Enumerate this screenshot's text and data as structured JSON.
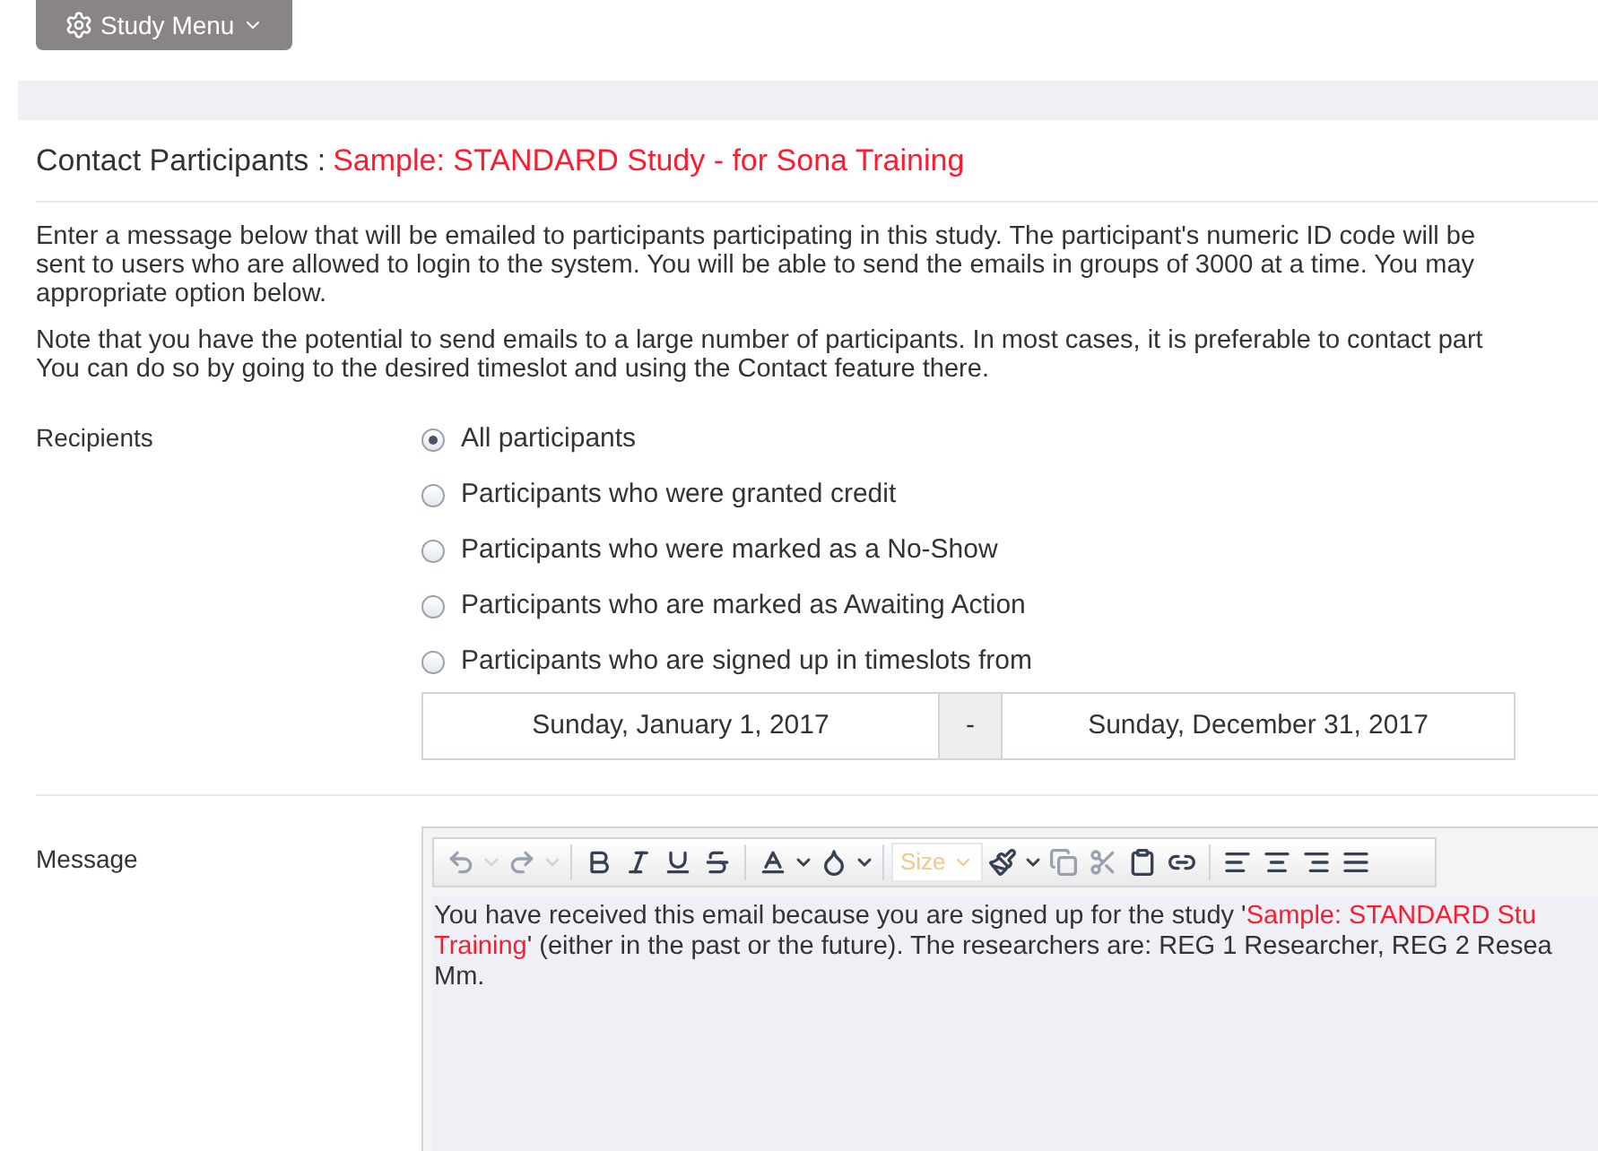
{
  "study_menu": {
    "label": "Study Menu"
  },
  "heading": {
    "label": "Contact Participants :",
    "study": "Sample: STANDARD Study - for Sona Training"
  },
  "intro_lines": [
    "Enter a message below that will be emailed to participants participating in this study. The participant's numeric ID code will be",
    "sent to users who are allowed to login to the system. You will be able to send the emails in groups of 3000 at a time. You may",
    "appropriate option below."
  ],
  "note_lines": [
    "Note that you have the potential to send emails to a large number of participants. In most cases, it is preferable to contact part",
    "You can do so by going to the desired timeslot and using the Contact feature there."
  ],
  "recipients": {
    "label": "Recipients",
    "options": [
      {
        "label": "All participants",
        "selected": true
      },
      {
        "label": "Participants who were granted credit",
        "selected": false
      },
      {
        "label": "Participants who were marked as a No-Show",
        "selected": false
      },
      {
        "label": "Participants who are marked as Awaiting Action",
        "selected": false
      },
      {
        "label": "Participants who are signed up in timeslots from",
        "selected": false
      }
    ]
  },
  "date_range": {
    "from": "Sunday, January 1, 2017",
    "separator": "-",
    "to": "Sunday, December 31, 2017"
  },
  "message": {
    "label": "Message",
    "size_placeholder": "Size",
    "lines": [
      [
        {
          "text": "You have received this email because you are signed up for the study '",
          "highlight": false
        },
        {
          "text": "Sample: STANDARD Stu",
          "highlight": true
        }
      ],
      [
        {
          "text": "Training",
          "highlight": true
        },
        {
          "text": "' (either in the past or the future). The researchers are: REG 1 Researcher, REG 2 Resea",
          "highlight": false
        }
      ],
      [
        {
          "text": "Mm.",
          "highlight": false
        }
      ]
    ]
  }
}
